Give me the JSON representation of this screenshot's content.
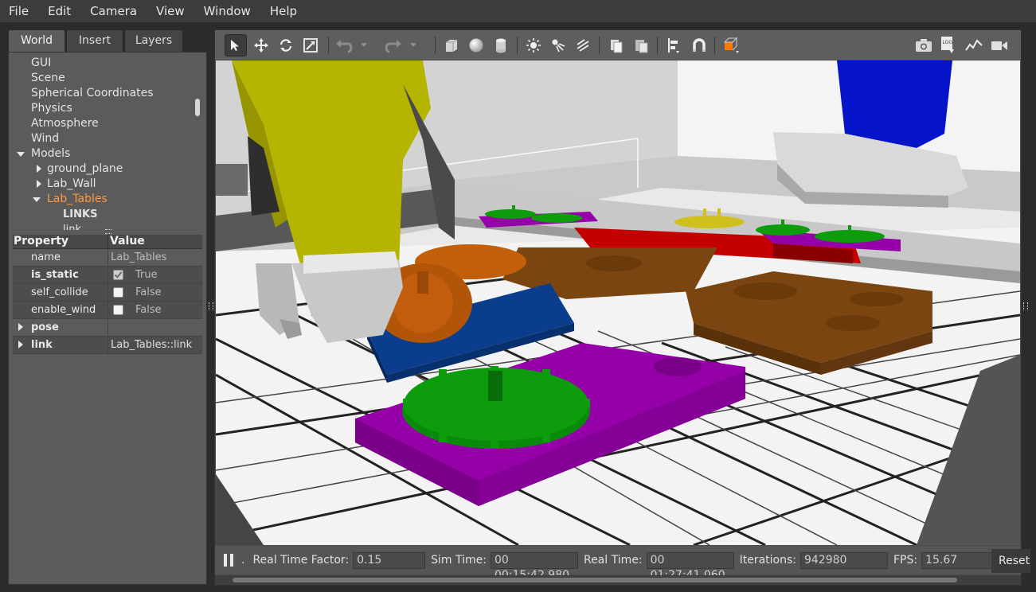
{
  "menu": [
    "File",
    "Edit",
    "Camera",
    "View",
    "Window",
    "Help"
  ],
  "left_tabs": [
    "World",
    "Insert",
    "Layers"
  ],
  "tree": {
    "gui": "GUI",
    "scene": "Scene",
    "spherical": "Spherical Coordinates",
    "physics": "Physics",
    "atmosphere": "Atmosphere",
    "wind": "Wind",
    "models": "Models",
    "ground_plane": "ground_plane",
    "lab_wall": "Lab_Wall",
    "lab_tables": "Lab_Tables",
    "links": "LINKS",
    "link_partial": "link"
  },
  "properties": {
    "header_property": "Property",
    "header_value": "Value",
    "name_key": "name",
    "name_value": "Lab_Tables",
    "is_static_key": "is_static",
    "is_static_value": "True",
    "self_collide_key": "self_collide",
    "self_collide_value": "False",
    "enable_wind_key": "enable_wind",
    "enable_wind_value": "False",
    "pose_key": "pose",
    "link_key": "link",
    "link_value": "Lab_Tables::link"
  },
  "status": {
    "rtf_label": "Real Time Factor:",
    "rtf_value": "0.15",
    "sim_label": "Sim Time:",
    "sim_value": "00 00:15:42.980",
    "real_label": "Real Time:",
    "real_value": "00 01:27:41.060",
    "iter_label": "Iterations:",
    "iter_value": "942980",
    "fps_label": "FPS:",
    "fps_value": "15.67",
    "reset_label": "Reset",
    "step_dot": "."
  },
  "colors": {
    "selected_tree": "#ff9a3c",
    "robot_yellow": "#b5b400",
    "gear_green": "#0c9c0c",
    "tray_purple": "#9600a8",
    "tray_blue": "#0a3d8c",
    "gear_orange": "#b35509",
    "tray_brown": "#7a4510",
    "tray_red": "#c40000",
    "robot_blue": "#0514c8"
  },
  "toolbar_icons": [
    "select-arrow-icon",
    "translate-icon",
    "rotate-icon",
    "scale-icon",
    "undo-icon",
    "undo-dropdown-icon",
    "redo-icon",
    "redo-dropdown-icon",
    "box-icon",
    "sphere-icon",
    "cylinder-icon",
    "point-light-icon",
    "spot-light-icon",
    "directional-light-icon",
    "copy-icon",
    "paste-icon",
    "align-icon",
    "snap-icon",
    "view-angle-icon",
    "screenshot-icon",
    "log-icon",
    "plot-icon",
    "video-icon"
  ]
}
